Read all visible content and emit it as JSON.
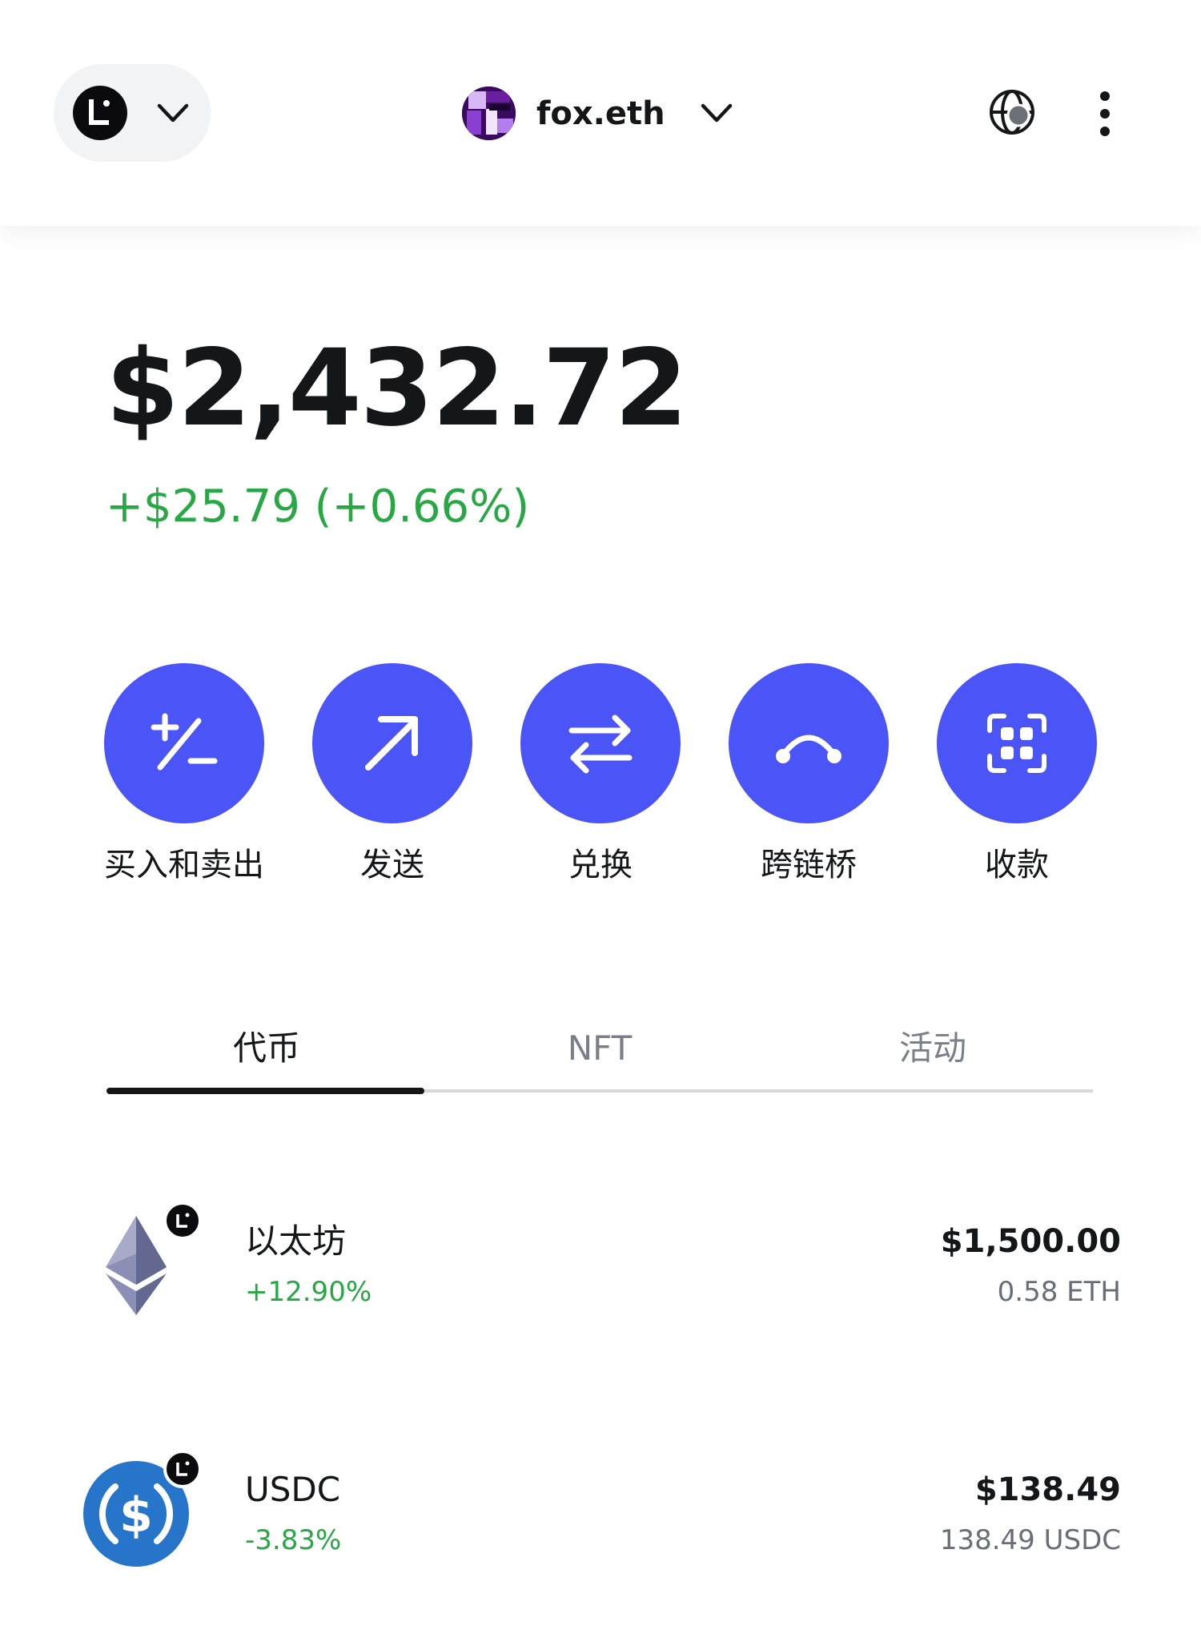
{
  "header": {
    "network_icon": "linea-logo-icon",
    "account_name": "fox.eth",
    "account_avatar_icon": "account-avatar-icon",
    "globe_icon": "globe-icon",
    "more_icon": "more-vertical-icon"
  },
  "balance": {
    "total": "$2,432.72",
    "change": "+$25.79 (+0.66%)",
    "change_color": "#28a745"
  },
  "actions": [
    {
      "label": "买入和卖出",
      "icon": "plus-minus-icon"
    },
    {
      "label": "发送",
      "icon": "arrow-up-right-icon"
    },
    {
      "label": "兑换",
      "icon": "swap-arrows-icon"
    },
    {
      "label": "跨链桥",
      "icon": "bridge-icon"
    },
    {
      "label": "收款",
      "icon": "qr-scan-icon"
    }
  ],
  "action_color": "#4b54f7",
  "tabs": [
    {
      "label": "代币",
      "active": true
    },
    {
      "label": "NFT",
      "active": false
    },
    {
      "label": "活动",
      "active": false
    }
  ],
  "tokens": [
    {
      "name": "以太坊",
      "change": "+12.90%",
      "fiat": "$1,500.00",
      "amount": "0.58 ETH",
      "icon": "ethereum-icon"
    },
    {
      "name": "USDC",
      "change": "-3.83%",
      "fiat": "$138.49",
      "amount": "138.49 USDC",
      "icon": "usdc-icon"
    }
  ]
}
